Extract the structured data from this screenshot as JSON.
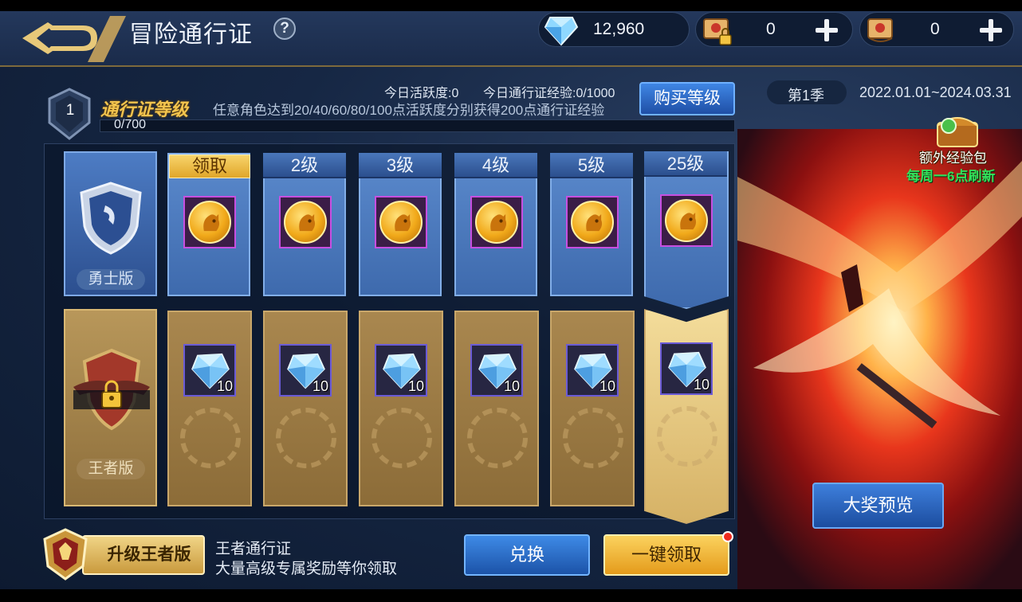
{
  "header": {
    "title": "冒险通行证",
    "help_label": "?",
    "currencies": {
      "diamond": "12,960",
      "ticket_locked": "0",
      "ticket": "0"
    }
  },
  "level": {
    "number": "1",
    "title": "通行证等级",
    "description": "任意角色达到20/40/60/80/100点活跃度分别获得200点通行证经验",
    "today_active": "今日活跃度:0",
    "today_exp": "今日通行证经验:0/1000",
    "buy_button": "购买等级",
    "progress_text": "0/700",
    "progress_value": 0
  },
  "season": {
    "label": "第1季",
    "dates": "2022.01.01~2024.03.31"
  },
  "tiers": {
    "free_label": "勇士版",
    "paid_label": "王者版"
  },
  "columns": [
    {
      "header": "领取",
      "claimable": true,
      "paid_count": "10"
    },
    {
      "header": "2级",
      "claimable": false,
      "paid_count": "10"
    },
    {
      "header": "3级",
      "claimable": false,
      "paid_count": "10"
    },
    {
      "header": "4级",
      "claimable": false,
      "paid_count": "10"
    },
    {
      "header": "5级",
      "claimable": false,
      "paid_count": "10"
    },
    {
      "header": "25级",
      "claimable": false,
      "paid_count": "10"
    }
  ],
  "bonus": {
    "title": "额外经验包",
    "refresh": "每周一6点刷新"
  },
  "preview_button": "大奖预览",
  "bottom": {
    "upgrade_button": "升级王者版",
    "king_pass": "王者通行证",
    "king_desc": "大量高级专属奖励等你领取",
    "exchange_button": "兑换",
    "claim_all_button": "一键领取"
  },
  "colors": {
    "gold": "#f2c44e",
    "blue_button": "#1f4fa6",
    "green_text": "#33e05a",
    "notice_dot": "#ee2a1e"
  }
}
